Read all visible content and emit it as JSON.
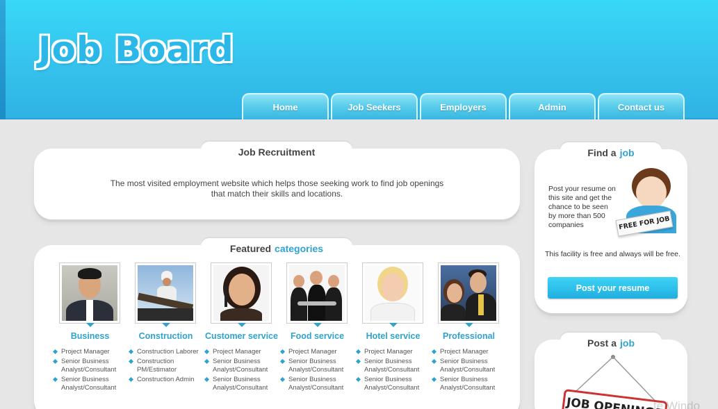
{
  "header": {
    "logo": "Job Board",
    "nav": [
      "Home",
      "Job Seekers",
      "Employers",
      "Admin",
      "Contact us"
    ]
  },
  "recruitment": {
    "title": "Job Recruitment",
    "line1": "The most visited employment website which helps those seeking work to find job openings",
    "line2": "that match their skills and locations."
  },
  "featured": {
    "title": "Featured",
    "accent": "categories",
    "categories": [
      {
        "name": "Business",
        "items": [
          "Project Manager",
          "Senior Business Analyst/Consultant",
          "Senior Business Analyst/Consultant"
        ]
      },
      {
        "name": "Construction",
        "items": [
          "Construction Laborer",
          "Construction PM/Estimator",
          "Construction Admin"
        ]
      },
      {
        "name": "Customer service",
        "items": [
          "Project Manager",
          "Senior Business Analyst/Consultant",
          "Senior Business Analyst/Consultant"
        ]
      },
      {
        "name": "Food service",
        "items": [
          "Project Manager",
          "Senior Business Analyst/Consultant",
          "Senior Business Analyst/Consultant"
        ]
      },
      {
        "name": "Hotel service",
        "items": [
          "Project Manager",
          "Senior Business Analyst/Consultant",
          "Senior Business Analyst/Consultant"
        ]
      },
      {
        "name": "Professional",
        "items": [
          "Project Manager",
          "Senior Business Analyst/Consultant",
          "Senior Business Analyst/Consultant"
        ]
      }
    ]
  },
  "find_job": {
    "title": "Find a",
    "accent": "job",
    "text": "Post your resume on this site and get the chance to be seen by more than 500 companies",
    "badge": "FREE FOR JOB",
    "note": "This facility is free and always will be free.",
    "button": "Post your resume"
  },
  "post_job": {
    "title": "Post a",
    "accent": "job",
    "sign": "JOB OPENINGS"
  },
  "watermark": "te Windo"
}
